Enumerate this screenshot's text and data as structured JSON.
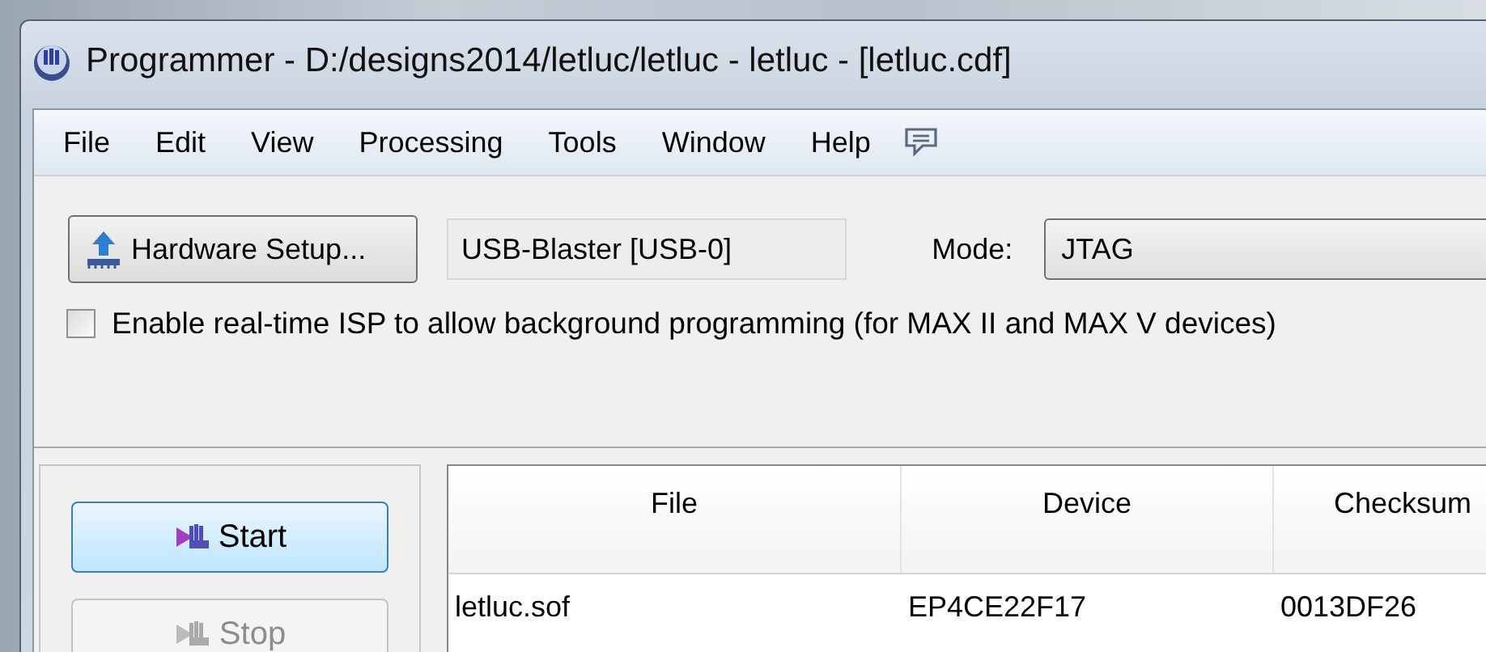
{
  "window": {
    "title": "Programmer - D:/designs2014/letluc/letluc - letluc - [letluc.cdf]"
  },
  "menu": [
    {
      "label": "File"
    },
    {
      "label": "Edit"
    },
    {
      "label": "View"
    },
    {
      "label": "Processing"
    },
    {
      "label": "Tools"
    },
    {
      "label": "Window"
    },
    {
      "label": "Help"
    }
  ],
  "toolbar": {
    "hardware_button": "Hardware Setup...",
    "hardware": "USB-Blaster [USB-0]",
    "mode_label": "Mode:",
    "mode": "JTAG"
  },
  "isp_option": {
    "label": "Enable real-time ISP to allow background programming (for MAX II and MAX V devices)",
    "checked": false
  },
  "actions": [
    {
      "label": "Start",
      "disabled": false
    },
    {
      "label": "Stop",
      "disabled": true
    }
  ],
  "table": {
    "columns": [
      "File",
      "Device",
      "Checksum"
    ],
    "rows": [
      [
        "letluc.sof",
        "EP4CE22F17",
        "0013DF26"
      ]
    ]
  }
}
